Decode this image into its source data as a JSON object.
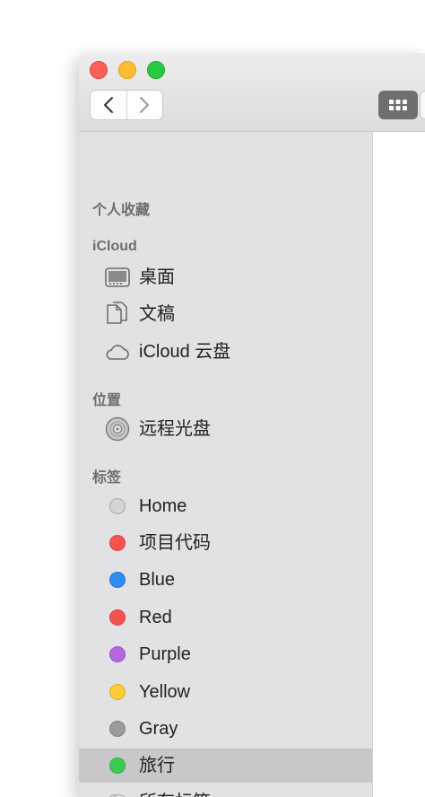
{
  "sidebar": {
    "favorites_header": "个人收藏",
    "icloud_header": "iCloud",
    "icloud_items": [
      {
        "label": "桌面",
        "icon": "desktop-icon"
      },
      {
        "label": "文稿",
        "icon": "document-icon"
      },
      {
        "label": "iCloud 云盘",
        "icon": "cloud-icon"
      }
    ],
    "locations_header": "位置",
    "location_items": [
      {
        "label": "远程光盘",
        "icon": "disc-icon"
      }
    ],
    "tags_header": "标签",
    "tags": [
      {
        "label": "Home",
        "color": "#d4d4d6"
      },
      {
        "label": "项目代码",
        "color": "#f6534f"
      },
      {
        "label": "Blue",
        "color": "#2d8cf6"
      },
      {
        "label": "Red",
        "color": "#f6534f"
      },
      {
        "label": "Purple",
        "color": "#b468dc"
      },
      {
        "label": "Yellow",
        "color": "#fdcb38"
      },
      {
        "label": "Gray",
        "color": "#9b9b9e"
      },
      {
        "label": "旅行",
        "color": "#3dcc52",
        "selected": true
      }
    ],
    "all_tags_label": "所有标签..."
  },
  "colors": {
    "sidebar_bg": "#e2e1e3",
    "selection": "#c8c7ca"
  }
}
